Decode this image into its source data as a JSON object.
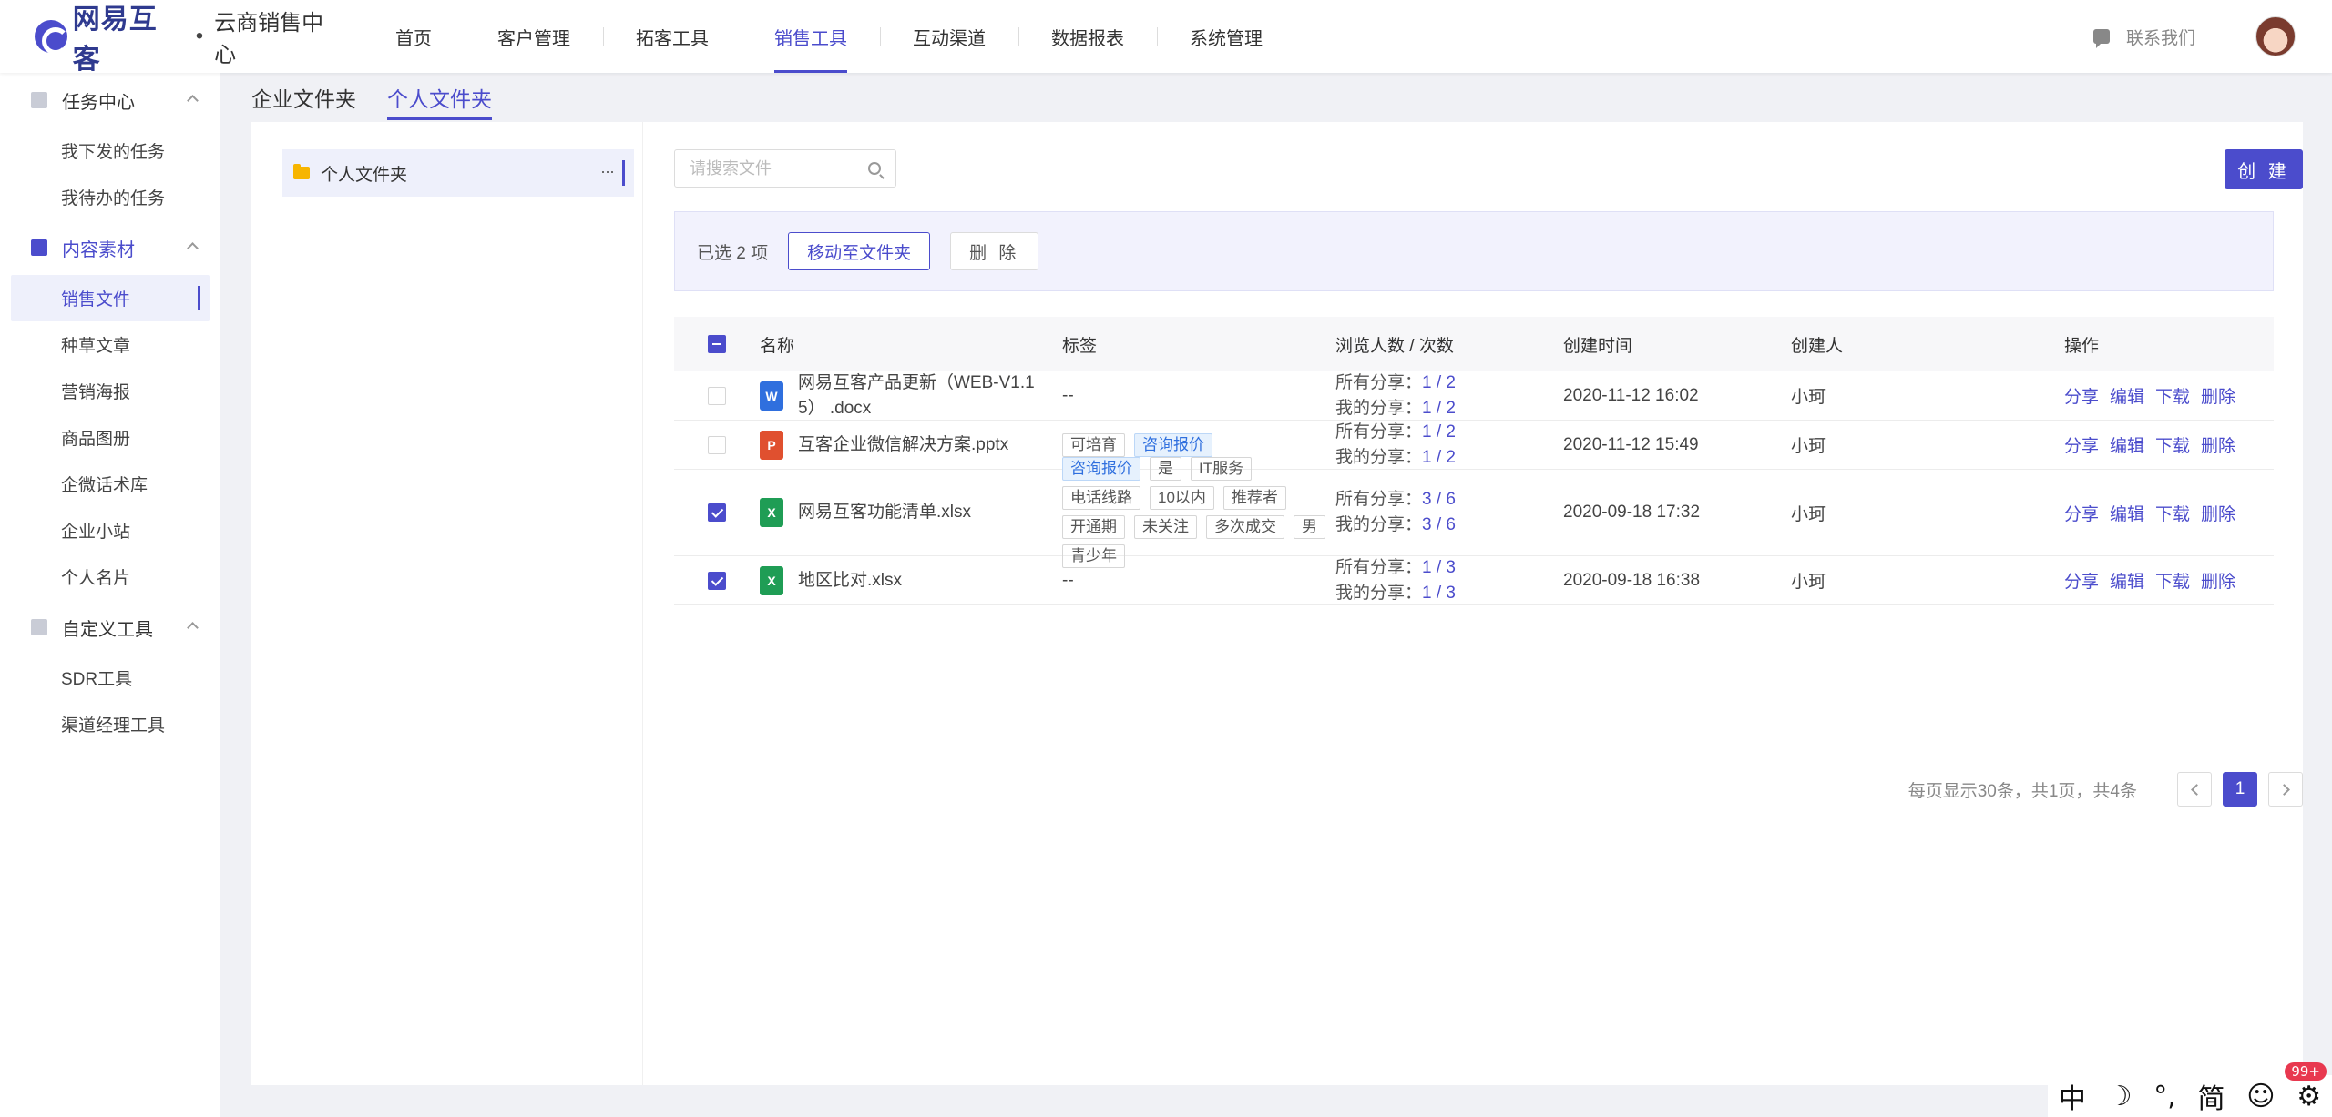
{
  "brand": {
    "name": "网易互客",
    "separator": "•",
    "product": "云商销售中心"
  },
  "nav": [
    {
      "label": "首页",
      "active": false
    },
    {
      "label": "客户管理",
      "active": false
    },
    {
      "label": "拓客工具",
      "active": false
    },
    {
      "label": "销售工具",
      "active": true
    },
    {
      "label": "互动渠道",
      "active": false
    },
    {
      "label": "数据报表",
      "active": false
    },
    {
      "label": "系统管理",
      "active": false
    }
  ],
  "header": {
    "contact": "联系我们"
  },
  "sidebar": {
    "groups": [
      {
        "label": "任务中心",
        "icon": "calendar-icon",
        "active": false,
        "items": [
          "我下发的任务",
          "我待办的任务"
        ]
      },
      {
        "label": "内容素材",
        "icon": "document-icon",
        "active": true,
        "items": [
          "销售文件",
          "种草文章",
          "营销海报",
          "商品图册",
          "企微话术库",
          "企业小站",
          "个人名片"
        ]
      },
      {
        "label": "自定义工具",
        "icon": "grid-icon",
        "active": false,
        "items": [
          "SDR工具",
          "渠道经理工具"
        ]
      }
    ],
    "active_item": "销售文件"
  },
  "tabs": [
    "企业文件夹",
    "个人文件夹"
  ],
  "active_tab": "个人文件夹",
  "folder": {
    "name": "个人文件夹",
    "more": "···"
  },
  "search": {
    "placeholder": "请搜索文件"
  },
  "create_label": "创 建",
  "selection": {
    "text": "已选 2 项",
    "move_label": "移动至文件夹",
    "delete_label": "删 除"
  },
  "table": {
    "columns": [
      "名称",
      "标签",
      "浏览人数 / 次数",
      "创建时间",
      "创建人",
      "操作"
    ],
    "rows": [
      {
        "checked": false,
        "type": "docx",
        "icon_letter": "W",
        "name_lines": [
          "网易互客产品更新（WEB-V1.1",
          "5） .docx"
        ],
        "tags": [],
        "empty_tags": "--",
        "all_share_label": "所有分享：",
        "all_share": "1 / 2",
        "my_share_label": "我的分享：",
        "my_share": "1 / 2",
        "created": "2020-11-12 16:02",
        "creator": "小珂"
      },
      {
        "checked": false,
        "type": "pptx",
        "icon_letter": "P",
        "name_lines": [
          "互客企业微信解决方案.pptx"
        ],
        "tags": [
          {
            "text": "可培育",
            "blue": false
          },
          {
            "text": "咨询报价",
            "blue": true
          }
        ],
        "empty_tags": "",
        "all_share_label": "所有分享：",
        "all_share": "1 / 2",
        "my_share_label": "我的分享：",
        "my_share": "1 / 2",
        "created": "2020-11-12 15:49",
        "creator": "小珂"
      },
      {
        "checked": true,
        "type": "xlsx",
        "icon_letter": "X",
        "name_lines": [
          "网易互客功能清单.xlsx"
        ],
        "tags": [
          {
            "text": "咨询报价",
            "blue": true
          },
          {
            "text": "是",
            "blue": false
          },
          {
            "text": "IT服务",
            "blue": false
          },
          {
            "text": "电话线路",
            "blue": false
          },
          {
            "text": "10以内",
            "blue": false
          },
          {
            "text": "推荐者",
            "blue": false
          },
          {
            "text": "开通期",
            "blue": false
          },
          {
            "text": "未关注",
            "blue": false
          },
          {
            "text": "多次成交",
            "blue": false
          },
          {
            "text": "男",
            "blue": false
          },
          {
            "text": "青少年",
            "blue": false
          }
        ],
        "empty_tags": "",
        "all_share_label": "所有分享：",
        "all_share": "3 / 6",
        "my_share_label": "我的分享：",
        "my_share": "3 / 6",
        "created": "2020-09-18 17:32",
        "creator": "小珂"
      },
      {
        "checked": true,
        "type": "xlsx",
        "icon_letter": "X",
        "name_lines": [
          "地区比对.xlsx"
        ],
        "tags": [],
        "empty_tags": "--",
        "all_share_label": "所有分享：",
        "all_share": "1 / 3",
        "my_share_label": "我的分享：",
        "my_share": "1 / 3",
        "created": "2020-09-18 16:38",
        "creator": "小珂"
      }
    ],
    "ops": [
      "分享",
      "编辑",
      "下载",
      "删除"
    ]
  },
  "pagination": {
    "info": "每页显示30条，共1页，共4条",
    "current": "1"
  },
  "ime": {
    "items": [
      "中",
      "☽",
      "°,",
      "简",
      "☺",
      "⚙"
    ],
    "badge": "99+"
  },
  "colors": {
    "accent": "#4b4ccc",
    "tag_blue": "#2f6fde",
    "excel": "#1f9d55",
    "word": "#2f6fde",
    "ppt": "#e0502f",
    "folder": "#f7b500"
  }
}
